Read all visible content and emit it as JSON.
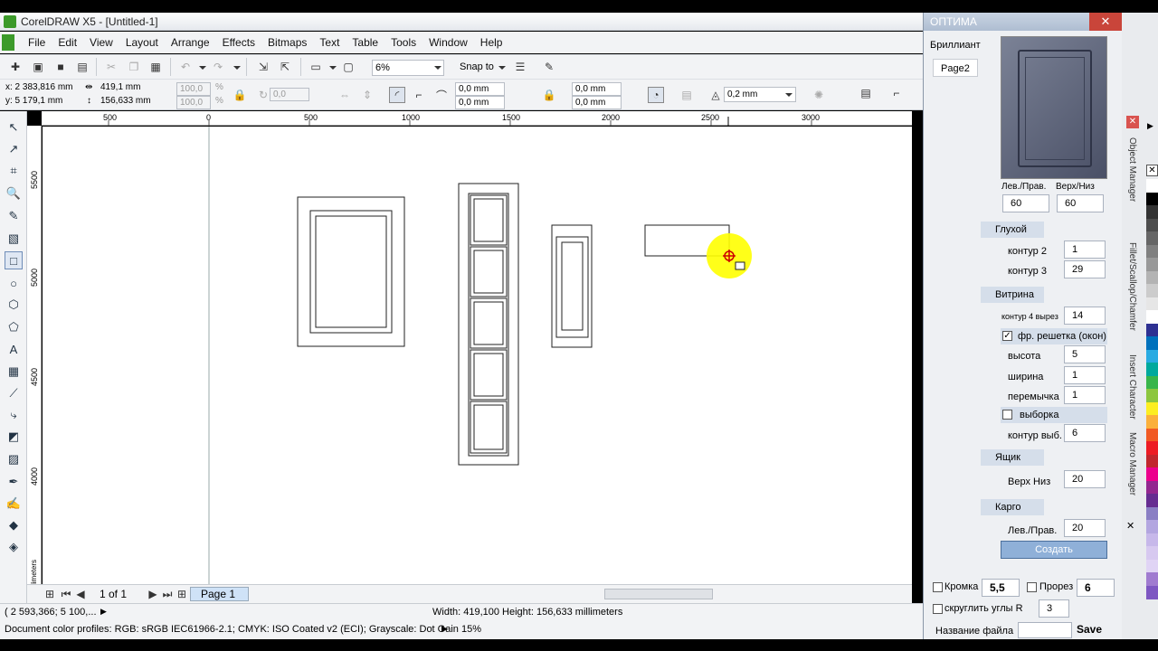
{
  "app": {
    "title": "CorelDRAW X5 - [Untitled-1]"
  },
  "menu": [
    "File",
    "Edit",
    "View",
    "Layout",
    "Arrange",
    "Effects",
    "Bitmaps",
    "Text",
    "Table",
    "Tools",
    "Window",
    "Help"
  ],
  "toolbar": {
    "zoom": "6%",
    "snap_to": "Snap to"
  },
  "propbar": {
    "x": "x: 2 383,816 mm",
    "y": "y: 5 179,1 mm",
    "width": "419,1 mm",
    "height": "156,633 mm",
    "scale_w": "100,0",
    "scale_h": "100,0",
    "unit": "%",
    "angle": "0,0",
    "corner1": "0,0 mm",
    "corner2": "0,0 mm",
    "corner3": "0,0 mm",
    "corner4": "0,0 mm",
    "outline": "0,2 mm"
  },
  "ruler_top": [
    {
      "label": "500"
    },
    {
      "label": "0"
    },
    {
      "label": "500"
    },
    {
      "label": "1000"
    },
    {
      "label": "1500"
    },
    {
      "label": "2000"
    },
    {
      "label": "2500"
    },
    {
      "label": "3000"
    }
  ],
  "ruler_left": [
    {
      "label": "5500"
    },
    {
      "label": "5000"
    },
    {
      "label": "4500"
    },
    {
      "label": "4000"
    }
  ],
  "ruler_unit": "millimeters",
  "pagebar": {
    "page_count": "1 of 1",
    "page_tab": "Page 1"
  },
  "status": {
    "coords": "( 2 593,366; 5 100,...",
    "dimensions": "Width: 419,100  Height: 156,633  millimeters",
    "color_profiles": "Document color profiles: RGB: sRGB IEC61966-2.1; CMYK: ISO Coated v2 (ECI); Grayscale: Dot Gain 15%"
  },
  "docker": {
    "title": "ОПТИМА",
    "tab_brilliant": "Бриллиант",
    "tab_page2": "Page2",
    "lev_prav_label": "Лев./Прав.",
    "verh_niz_label": "Верх/Низ",
    "lev_prav_value": "60",
    "verh_niz_value": "60",
    "gluhoy": {
      "label": "Глухой",
      "kontur2_label": "контур 2",
      "kontur2": "1",
      "kontur3_label": "контур 3",
      "kontur3": "29"
    },
    "vitrina": {
      "label": "Витрина",
      "kontur4_label": "контур 4 вырез",
      "kontur4": "14",
      "reshetka_label": "фр. решетка (окон)",
      "vysota_label": "высота",
      "vysota": "5",
      "shirina_label": "ширина",
      "shirina": "1",
      "peremychka_label": "перемычка",
      "peremychka": "1",
      "vyborka_label": "выборка",
      "kontur_vyb_label": "контур выб.",
      "kontur_vyb": "6"
    },
    "yashik": {
      "label": "Ящик",
      "verh_niz_label": "Верх Низ",
      "verh_niz": "20"
    },
    "kargo": {
      "label": "Карго",
      "lev_prav_label": "Лев./Прав.",
      "lev_prav": "20"
    },
    "create_button": "Создать",
    "kromka_label": "Кромка",
    "kromka": "5,5",
    "prorez_label": "Прорез",
    "prorez": "6",
    "round_label": "скруглить углы R",
    "round": "3",
    "filename_label": "Название файла",
    "filename": "",
    "save_button": "Save"
  },
  "side_tabs": [
    "Object Manager",
    "Fillet/Scallop/Chamfer",
    "Insert Character",
    "Macro Manager"
  ],
  "palette": [
    "#ffffff",
    "#000000",
    "#333333",
    "#4d4d4d",
    "#666666",
    "#808080",
    "#999999",
    "#b3b3b3",
    "#cccccc",
    "#e6e6e6",
    "#ffffff",
    "#2e3192",
    "#0071bc",
    "#29abe2",
    "#00a99d",
    "#39b54a",
    "#8cc63f",
    "#fcee21",
    "#fbb03b",
    "#f15a24",
    "#ed1c24",
    "#c1272d",
    "#ec008c",
    "#93278f",
    "#662d91",
    "#8a7fc4",
    "#b3a6e0",
    "#c7b8ea",
    "#d7c9f0",
    "#e0d4f5",
    "#a07bd0",
    "#7e57c2"
  ]
}
